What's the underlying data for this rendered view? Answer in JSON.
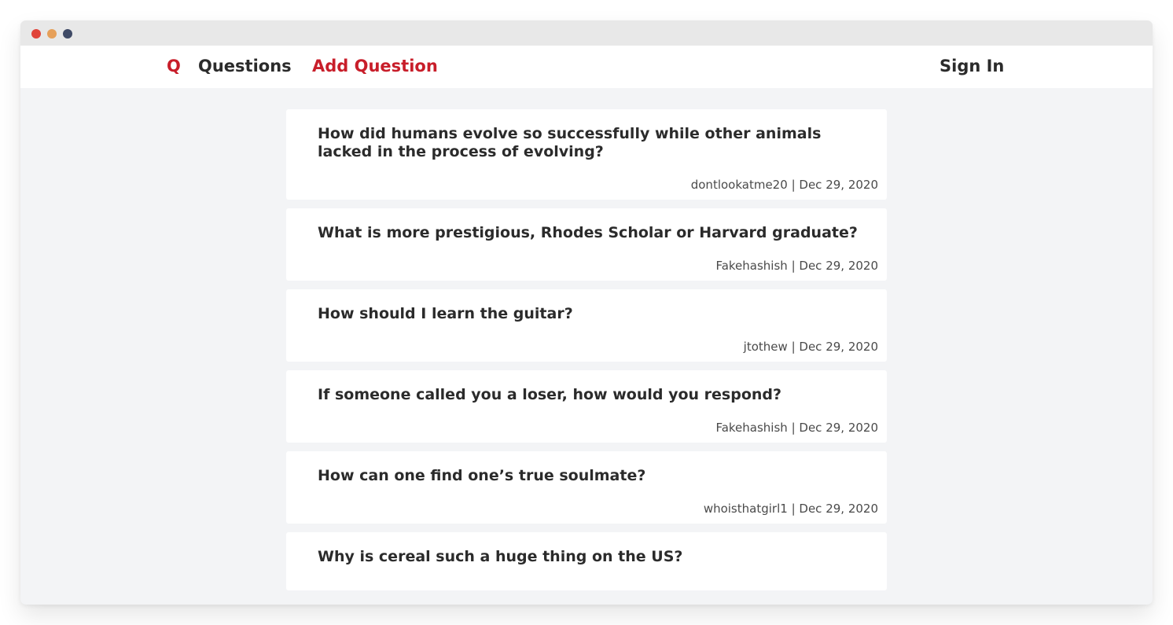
{
  "window": {
    "dots": [
      {
        "name": "close",
        "color": "#e0443a"
      },
      {
        "name": "minimize",
        "color": "#e6a05a"
      },
      {
        "name": "maximize",
        "color": "#3f4a66"
      }
    ]
  },
  "colors": {
    "accent": "#c81e2a",
    "text": "#2b2b2b",
    "meta_text": "#4a4a4a",
    "background": "#f3f4f6",
    "card": "#ffffff"
  },
  "nav": {
    "logo": "Q",
    "questions": "Questions",
    "add_question": "Add Question",
    "sign_in": "Sign In"
  },
  "questions": [
    {
      "title": "How did humans evolve so successfully while other animals lacked in the process of evolving?",
      "author": "dontlookatme20",
      "separator": "|",
      "date": "Dec 29, 2020"
    },
    {
      "title": "What is more prestigious, Rhodes Scholar or Harvard graduate?",
      "author": "Fakehashish",
      "separator": "|",
      "date": "Dec 29, 2020"
    },
    {
      "title": "How should I learn the guitar?",
      "author": "jtothew",
      "separator": "|",
      "date": "Dec 29, 2020"
    },
    {
      "title": "If someone called you a loser, how would you respond?",
      "author": "Fakehashish",
      "separator": "|",
      "date": "Dec 29, 2020"
    },
    {
      "title": "How can one find one’s true soulmate?",
      "author": "whoisthatgirl1",
      "separator": "|",
      "date": "Dec 29, 2020"
    },
    {
      "title": "Why is cereal such a huge thing on the US?",
      "author": "",
      "separator": "",
      "date": ""
    }
  ]
}
